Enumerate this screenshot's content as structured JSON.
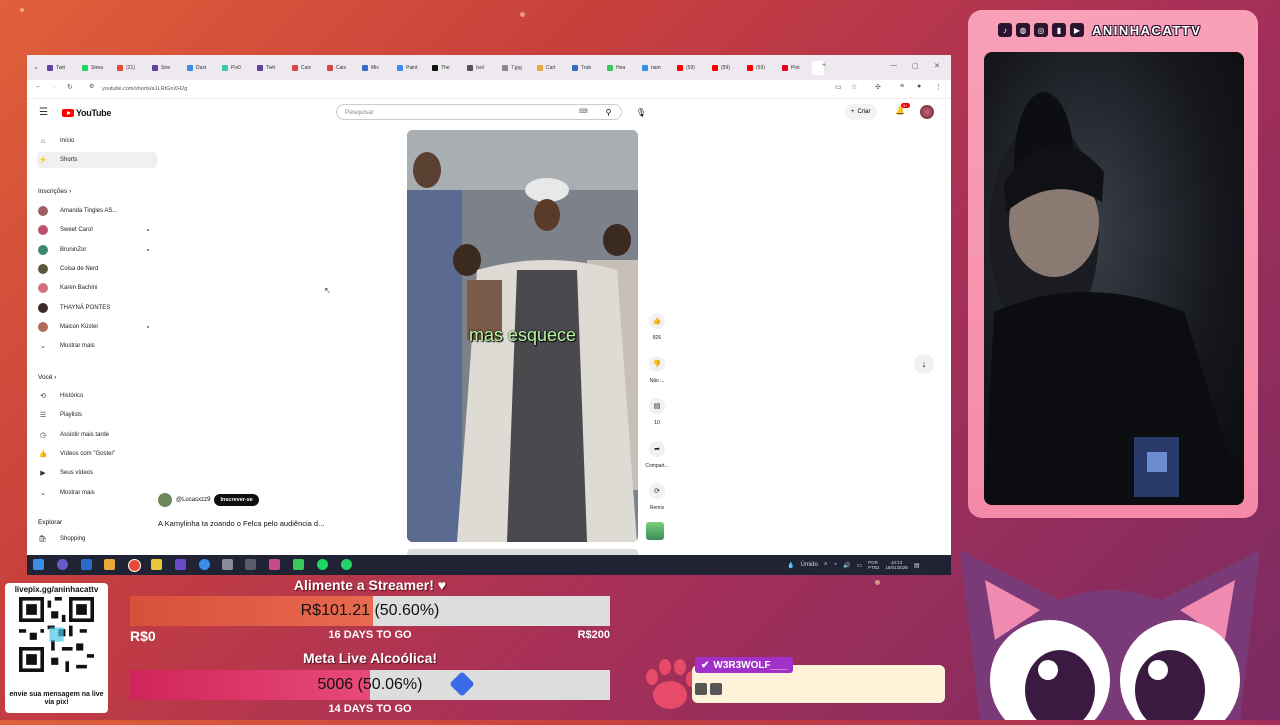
{
  "browser": {
    "tabs": [
      "Twit",
      "Strea",
      "(21)",
      "Stre",
      "Dast",
      "Pix0",
      "Twit",
      "Caix",
      "Caix",
      "Mix",
      "Paint",
      "The",
      "Isol",
      "7.jpg",
      "Cart",
      "Trab",
      "Hea",
      "nam",
      "(59)",
      "(59)",
      "(59)",
      "Pint"
    ],
    "url": "youtube.com/shorts/a1LRtGnXH2g"
  },
  "youtube": {
    "logo_text": "YouTube",
    "search_placeholder": "Pesquisar",
    "create_label": "Criar",
    "notif_count": "9+",
    "nav": [
      {
        "label": "Início",
        "icon": "home-icon"
      },
      {
        "label": "Shorts",
        "icon": "shorts-icon"
      }
    ],
    "subs_header": "Inscrições",
    "subscriptions": [
      {
        "name": "Amanda Tingles AS...",
        "color": "#a06060",
        "dot": false
      },
      {
        "name": "Sweet Carol",
        "color": "#c05070",
        "dot": true
      },
      {
        "name": "BruninZor",
        "color": "#3a8a6a",
        "dot": true
      },
      {
        "name": "Coisa de Nerd",
        "color": "#5a5a3a",
        "dot": false
      },
      {
        "name": "Karen Bachini",
        "color": "#d07080",
        "dot": false
      },
      {
        "name": "THAYNÁ PONTES",
        "color": "#3a2a2a",
        "dot": false
      },
      {
        "name": "Maicon Küster",
        "color": "#b06a5a",
        "dot": true
      }
    ],
    "show_more": "Mostrar mais",
    "you_header": "Você",
    "you_items": [
      {
        "label": "Histórico",
        "icon": "history-icon"
      },
      {
        "label": "Playlists",
        "icon": "playlist-icon"
      },
      {
        "label": "Assistir mais tarde",
        "icon": "clock-icon"
      },
      {
        "label": "Vídeos com \"Gostei\"",
        "icon": "thumbs-up-icon"
      },
      {
        "label": "Seus vídeos",
        "icon": "video-icon"
      },
      {
        "label": "Mostrar mais",
        "icon": "chevron-down-icon"
      }
    ],
    "explore_header": "Explorar",
    "explore_items": [
      {
        "label": "Shopping",
        "icon": "shopping-icon"
      }
    ],
    "short": {
      "caption": "mas esquece",
      "likes": "826",
      "dislike_label": "Não ...",
      "comments": "10",
      "share_label": "Compart...",
      "remix_label": "Remix",
      "channel": "@Lucasxzz9",
      "subscribe_label": "Inscrever-se",
      "title": "A Kamylinha ta zoando o Felca pelo audiência d..."
    }
  },
  "taskbar": {
    "weather": "Úmido",
    "lang": "POR",
    "lang2": "PTB2",
    "time": "10:13",
    "date": "16/01/2026"
  },
  "webcam": {
    "channel_name": "ANINHACATTV"
  },
  "donation": {
    "qr_title": "livepix.gg/aninhacattv",
    "qr_footer": "envie sua mensagem na live via pix!",
    "goal1": {
      "title": "Alimente a Streamer! ♥",
      "amount_text": "R$101.21 (50.60%)",
      "progress": 0.506,
      "min": "R$0",
      "max": "R$200",
      "days_left": "16 DAYS TO GO",
      "fill_color": "#d8503a"
    },
    "goal2": {
      "title": "Meta Live Alcoólica!",
      "amount_text": "5006 (50.06%)",
      "progress": 0.5006,
      "days_left": "14 DAYS TO GO",
      "fill_color": "#d0245a"
    }
  },
  "chat": {
    "user": "W3R3WOLF___"
  }
}
